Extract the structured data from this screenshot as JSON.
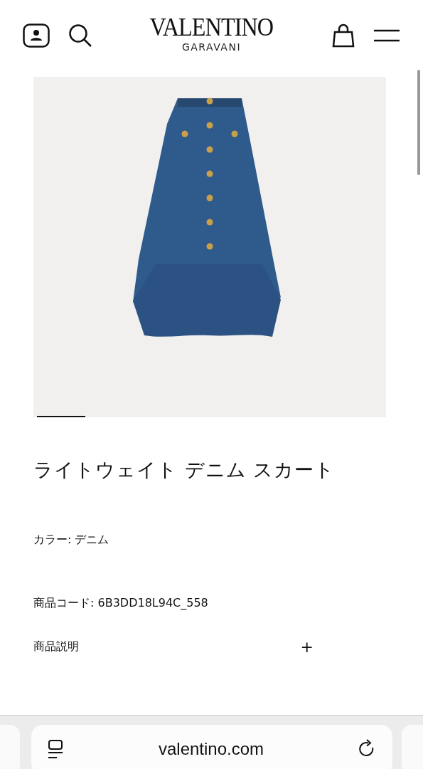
{
  "header": {
    "brand": "VALENTINO",
    "sub_brand": "GARAVANI"
  },
  "product": {
    "title": "ライトウェイト デニム スカート",
    "color_text": "カラー: デニム",
    "code": "商品コード: 6B3DD18L94C_558",
    "description": {
      "label": "商品説明",
      "toggle": "+",
      "expanded": false
    }
  },
  "browser": {
    "url": "valentino.com"
  }
}
